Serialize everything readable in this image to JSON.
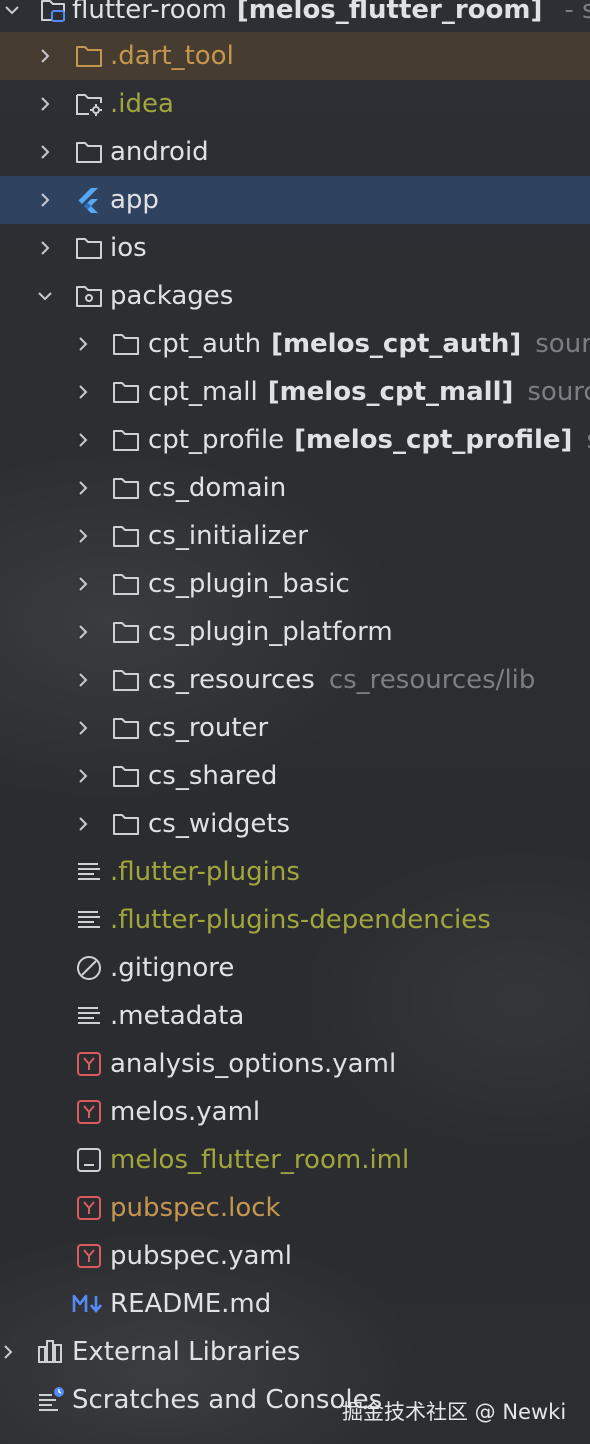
{
  "project_tree": {
    "root": {
      "name": "flutter-room",
      "module": "[melos_flutter_room]",
      "suffix": "- so"
    },
    "items": [
      {
        "id": "dart_tool",
        "label": ".dart_tool",
        "icon": "folder-icon",
        "color": "#c59650"
      },
      {
        "id": "idea",
        "label": ".idea",
        "icon": "settings-folder-icon",
        "color": "#a0a63c"
      },
      {
        "id": "android",
        "label": "android",
        "icon": "folder-icon"
      },
      {
        "id": "app",
        "label": "app",
        "icon": "flutter-icon"
      },
      {
        "id": "ios",
        "label": "ios",
        "icon": "folder-icon"
      },
      {
        "id": "packages",
        "label": "packages",
        "icon": "package-folder-icon"
      },
      {
        "id": "cpt_auth",
        "label": "cpt_auth",
        "module": "[melos_cpt_auth]",
        "suffix": "sourc",
        "icon": "folder-icon"
      },
      {
        "id": "cpt_mall",
        "label": "cpt_mall",
        "module": "[melos_cpt_mall]",
        "suffix": "source",
        "icon": "folder-icon"
      },
      {
        "id": "cpt_profile",
        "label": "cpt_profile",
        "module": "[melos_cpt_profile]",
        "suffix": "so",
        "icon": "folder-icon"
      },
      {
        "id": "cs_domain",
        "label": "cs_domain",
        "icon": "folder-icon"
      },
      {
        "id": "cs_initializer",
        "label": "cs_initializer",
        "icon": "folder-icon"
      },
      {
        "id": "cs_plugin_basic",
        "label": "cs_plugin_basic",
        "icon": "folder-icon"
      },
      {
        "id": "cs_plugin_platform",
        "label": "cs_plugin_platform",
        "icon": "folder-icon"
      },
      {
        "id": "cs_resources",
        "label": "cs_resources",
        "suffix": "cs_resources/lib",
        "icon": "folder-icon"
      },
      {
        "id": "cs_router",
        "label": "cs_router",
        "icon": "folder-icon"
      },
      {
        "id": "cs_shared",
        "label": "cs_shared",
        "icon": "folder-icon"
      },
      {
        "id": "cs_widgets",
        "label": "cs_widgets",
        "icon": "folder-icon"
      },
      {
        "id": "flutter_plugins",
        "label": ".flutter-plugins",
        "icon": "text-file-icon",
        "color": "#a0a63c"
      },
      {
        "id": "flutter_plugins_dependencies",
        "label": ".flutter-plugins-dependencies",
        "icon": "text-file-icon",
        "color": "#a0a63c"
      },
      {
        "id": "gitignore",
        "label": ".gitignore",
        "icon": "gitignore-icon"
      },
      {
        "id": "metadata",
        "label": ".metadata",
        "icon": "text-file-icon"
      },
      {
        "id": "analysis_options",
        "label": "analysis_options.yaml",
        "icon": "yaml-file-icon"
      },
      {
        "id": "melos_yaml",
        "label": "melos.yaml",
        "icon": "yaml-file-icon"
      },
      {
        "id": "melos_iml",
        "label": "melos_flutter_room.iml",
        "icon": "module-file-icon",
        "color": "#a0a63c"
      },
      {
        "id": "pubspec_lock",
        "label": "pubspec.lock",
        "icon": "yaml-file-icon",
        "color": "#c59650"
      },
      {
        "id": "pubspec_yaml",
        "label": "pubspec.yaml",
        "icon": "yaml-file-icon"
      },
      {
        "id": "readme",
        "label": "README.md",
        "icon": "markdown-file-icon"
      },
      {
        "id": "external_libraries",
        "label": "External Libraries",
        "icon": "library-icon"
      },
      {
        "id": "scratches",
        "label": "Scratches and Consoles",
        "icon": "scratches-icon"
      }
    ]
  },
  "watermark": "掘金技术社区 @ Newki",
  "colors": {
    "background": "#2b2d31",
    "selected": "#2f4260",
    "excluded": "#765629",
    "olive_text": "#a0a63c",
    "orange_text": "#c59650",
    "dim_text": "#7a7e85",
    "folder_outline": "#ced0d6",
    "yaml_red": "#db5c5c",
    "markdown_blue": "#548af7",
    "flutter_blue": "#56a8f5"
  }
}
